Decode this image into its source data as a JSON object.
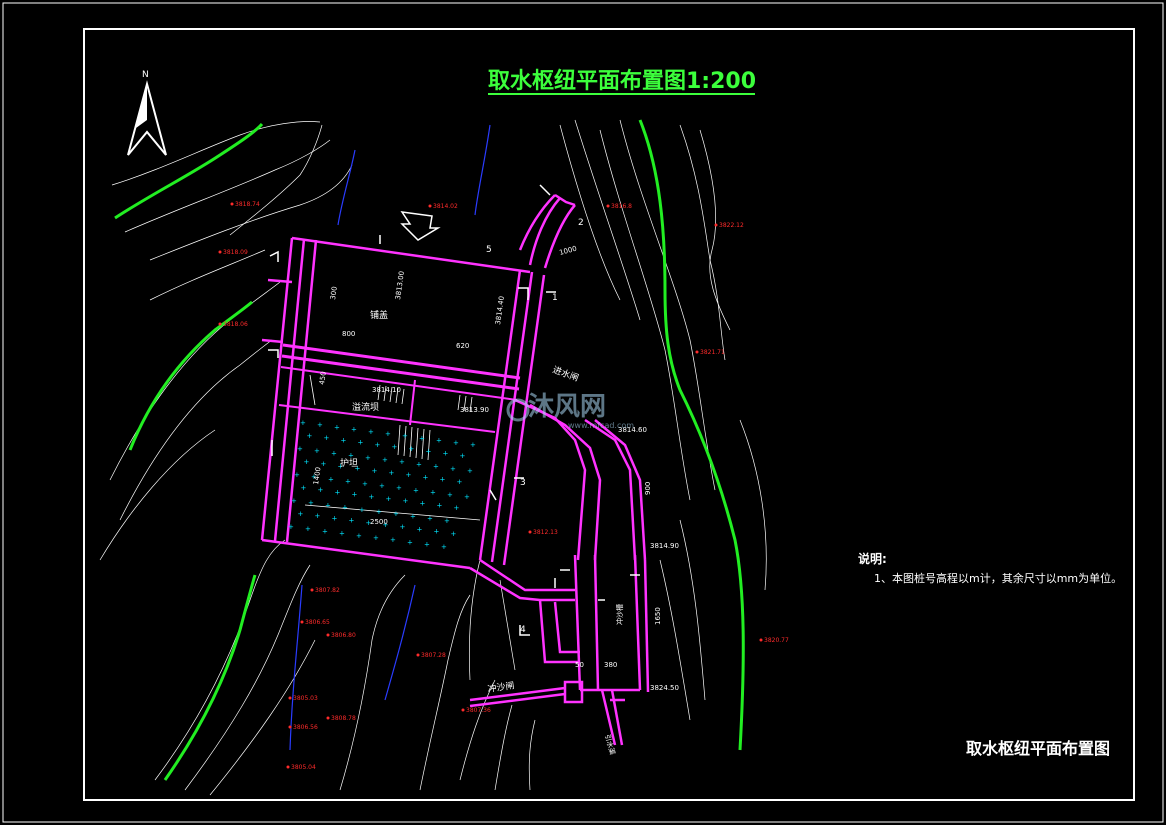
{
  "drawing": {
    "title": "取水枢纽平面布置图1:200",
    "north": "N",
    "stamp_title": "取水枢纽平面布置图",
    "notes": {
      "heading": "说明:",
      "lines": [
        "1、本图桩号高程以m计，其余尺寸以mm为单位。"
      ]
    },
    "watermark": "沐风网",
    "watermark_url": "www.mfcad.com",
    "colors": {
      "background": "#000000",
      "frame": "#ffffff",
      "structure": "#ff33ff",
      "contour_index": "#22ee22",
      "contour": "#ffffff",
      "stream": "#2a3cff",
      "elevation": "#ff2b2b",
      "riprap": "#00e5ff",
      "title": "#3cff3c"
    },
    "elevations": [
      "3818.74",
      "3814.02",
      "3816.8",
      "3822.12",
      "3818.09",
      "3818.06",
      "3821.71",
      "3812.13",
      "3820.77",
      "3807.82",
      "3806.65",
      "3806.80",
      "3807.28",
      "3805.03",
      "3808.78",
      "3806.56",
      "3807.36",
      "3805.04"
    ],
    "labels": {
      "reservoir": "铺盖",
      "weir": "溢流坝",
      "apron": "护坦",
      "approach": "进水闸",
      "sluice": "冲沙闸",
      "canal": "引水渠",
      "flushing": "冲沙槽",
      "dim_300": "300",
      "dim_800": "800",
      "dim_620": "620",
      "dim_450": "450",
      "dim_1400": "1400",
      "dim_2500": "2500",
      "dim_1000": "1000",
      "dim_380": "380",
      "dim_50": "50",
      "dim_1650": "1650",
      "dim_900": "900",
      "el_3813_0": "3813.00",
      "el_3814_1": "3814.10",
      "el_3813_9": "3813.90",
      "el_3814_4": "3814.40",
      "el_3814_9": "3814.90",
      "el_3814_6": "3814.60",
      "el_3824_5": "3824.50",
      "sec_1": "1",
      "sec_2": "2",
      "sec_3": "3",
      "sec_4": "4",
      "sec_5": "5"
    }
  }
}
